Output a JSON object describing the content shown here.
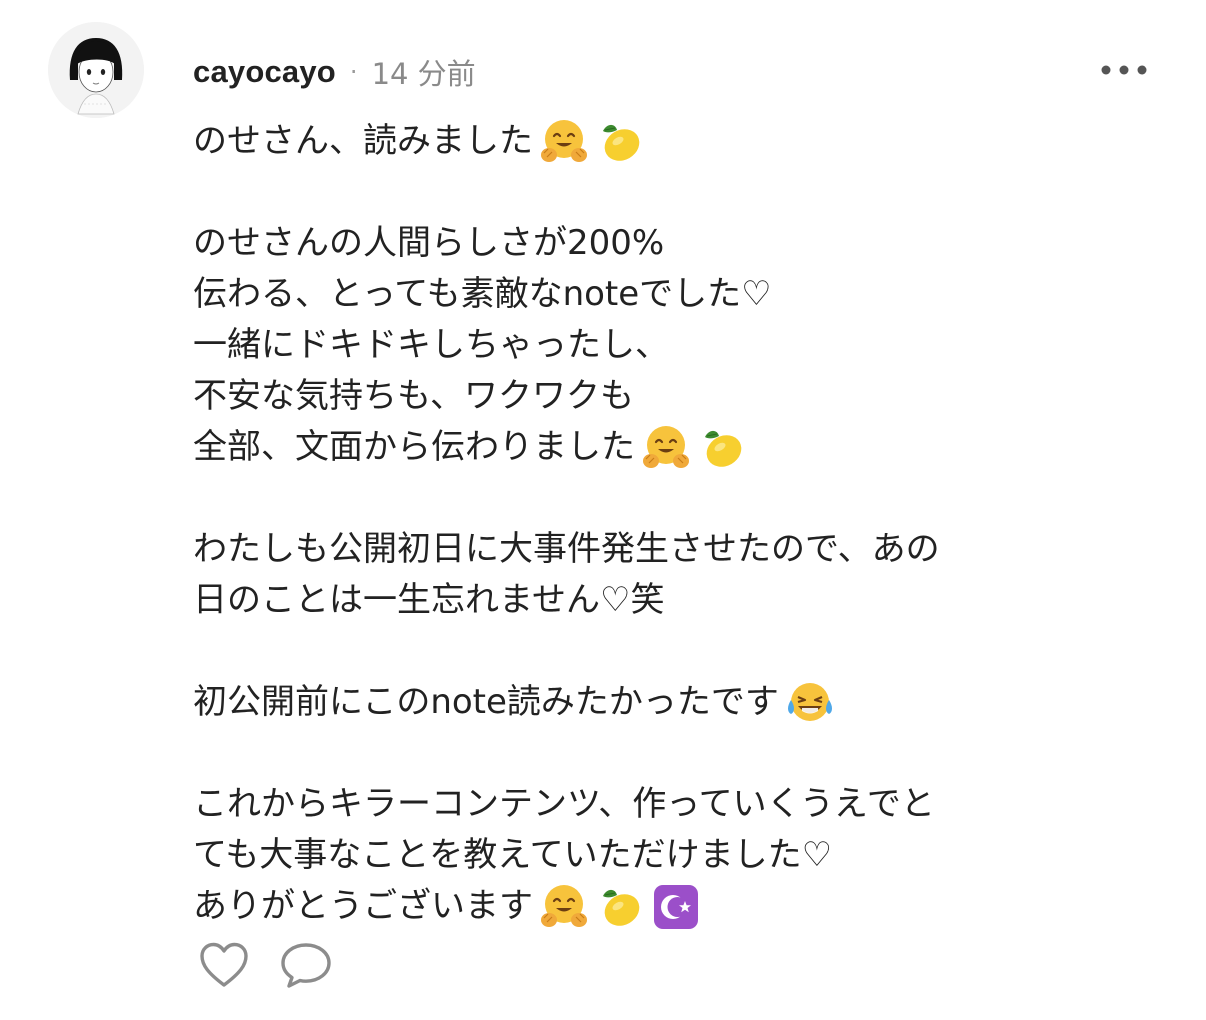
{
  "comment": {
    "author": "cayocayo",
    "separator": "·",
    "time": "14 分前",
    "lines": [
      {
        "text": "のせさん、読みました",
        "emojis": [
          "hugging-face-icon",
          "lemon-icon"
        ]
      },
      {
        "text": ""
      },
      {
        "text": "のせさんの人間らしさが200%"
      },
      {
        "text": "伝わる、とっても素敵なnoteでした♡"
      },
      {
        "text": "一緒にドキドキしちゃったし、"
      },
      {
        "text": "不安な気持ちも、ワクワクも"
      },
      {
        "text": "全部、文面から伝わりました",
        "emojis": [
          "hugging-face-icon",
          "lemon-icon"
        ]
      },
      {
        "text": ""
      },
      {
        "text": "わたしも公開初日に大事件発生させたので、あの"
      },
      {
        "text": "日のことは一生忘れません♡笑"
      },
      {
        "text": ""
      },
      {
        "text": "初公開前にこのnote読みたかったです",
        "emojis": [
          "tears-of-joy-icon"
        ]
      },
      {
        "text": ""
      },
      {
        "text": "これからキラーコンテンツ、作っていくうえでと"
      },
      {
        "text": "ても大事なことを教えていただけました♡"
      },
      {
        "text": "ありがとうございます",
        "emojis": [
          "hugging-face-icon",
          "lemon-icon",
          "star-and-crescent-icon"
        ]
      }
    ],
    "actions": [
      "heart-icon",
      "speech-bubble-icon"
    ]
  },
  "colors": {
    "text": "#222222",
    "meta": "#8a8a8a",
    "icon": "#8c8c8c",
    "crescent_bg": "#8e44ad",
    "lemon": "#f7cf2f"
  }
}
